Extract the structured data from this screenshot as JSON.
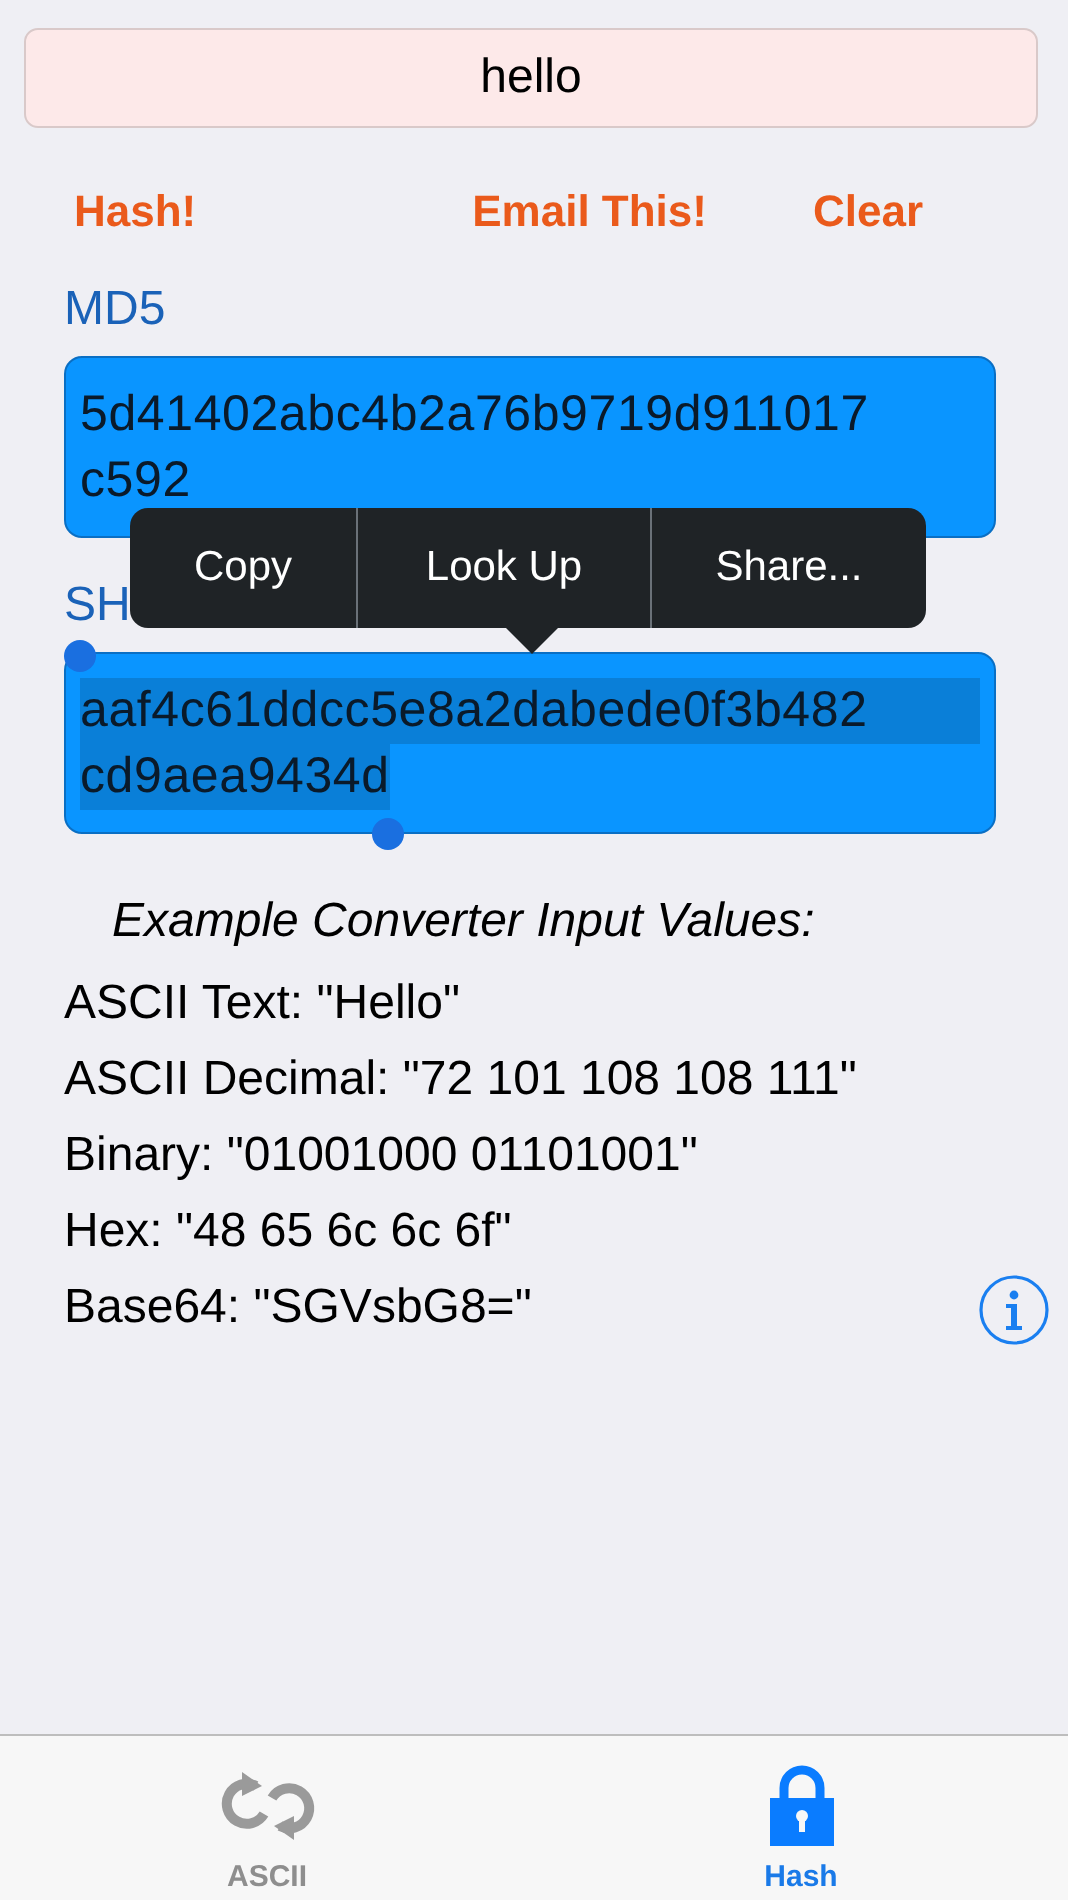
{
  "input": {
    "value": "hello"
  },
  "actions": [
    "Hash!",
    "Email This!",
    "Clear"
  ],
  "hashes": [
    {
      "label": "MD5",
      "value_lines": [
        "5d41402abc4b2a76b9719d911017",
        "c592"
      ],
      "selected": false
    },
    {
      "label": "SH",
      "value_lines": [
        "aaf4c61ddcc5e8a2dabede0f3b482",
        "cd9aea9434d"
      ],
      "selected": true
    }
  ],
  "edit_menu": {
    "items": [
      "Copy",
      "Look Up",
      "Share..."
    ]
  },
  "examples": {
    "title": "Example Converter Input Values:",
    "lines": [
      "ASCII Text: \"Hello\"",
      "ASCII Decimal: \"72 101 108 108 111\"",
      "Binary: \"01001000 01101001\"",
      "Hex: \"48 65 6c 6c 6f\"",
      "Base64: \"SGVsbG8=\""
    ]
  },
  "tab_bar": [
    {
      "label": "ASCII",
      "kind": "convert",
      "selected": false
    },
    {
      "label": "Hash",
      "kind": "lock",
      "selected": true
    }
  ]
}
